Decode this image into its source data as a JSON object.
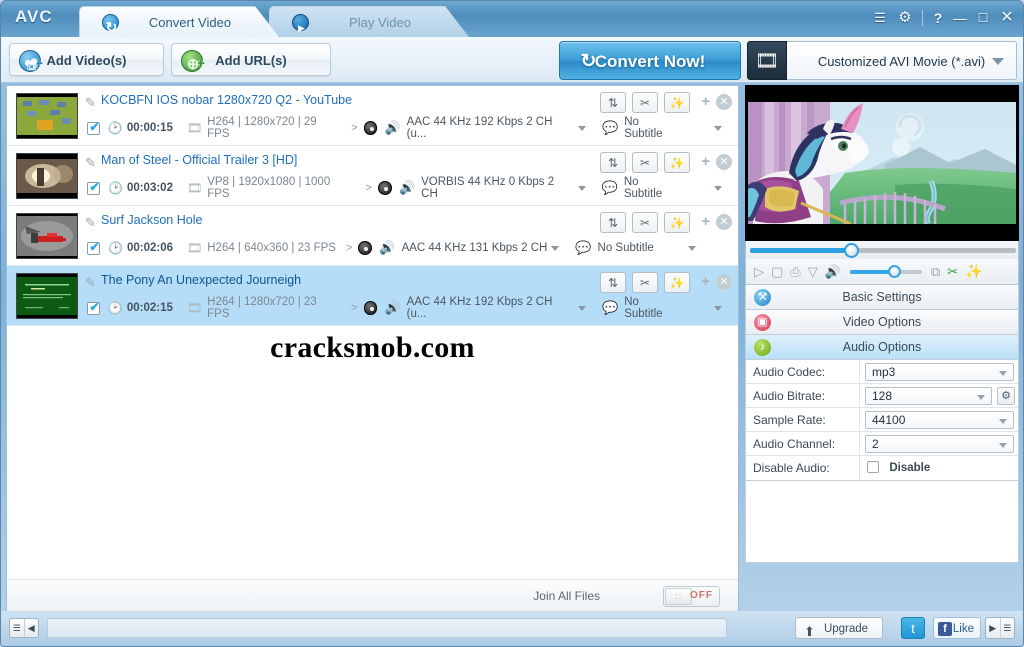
{
  "window": {
    "logo": "AVC",
    "controls": [
      {
        "name": "list-icon",
        "glyph": "☰"
      },
      {
        "name": "gear-icon",
        "glyph": "⚙"
      },
      {
        "name": "help-icon",
        "glyph": "?"
      },
      {
        "name": "minimize-icon",
        "glyph": "—"
      },
      {
        "name": "maximize-icon",
        "glyph": "☐"
      },
      {
        "name": "close-icon",
        "glyph": "✕"
      }
    ]
  },
  "tabs": [
    {
      "label": "Convert Video",
      "active": true
    },
    {
      "label": "Play Video",
      "active": false
    }
  ],
  "toolbar": {
    "add_video_label": "Add Video(s)",
    "add_url_label": "Add URL(s)",
    "convert_label": "Convert Now!",
    "convert_icon": "↻",
    "profile_value": "Customized AVI Movie (*.avi)"
  },
  "files": [
    {
      "title": "KOCBFN IOS nobar 1280x720 Q2 - YouTube",
      "duration": "00:00:15",
      "video_info": "H264 | 1280x720 | 29 FPS",
      "audio_info": "AAC 44 KHz 192 Kbps 2 CH (u...",
      "subtitle": "No Subtitle",
      "checked": true,
      "selected": false,
      "thumb": "game"
    },
    {
      "title": "Man of Steel - Official Trailer 3 [HD]",
      "duration": "00:03:02",
      "video_info": "VP8 | 1920x1080 | 1000 FPS",
      "audio_info": "VORBIS 44 KHz 0 Kbps 2 CH",
      "subtitle": "No Subtitle",
      "checked": true,
      "selected": false,
      "thumb": "trailer"
    },
    {
      "title": "Surf Jackson Hole",
      "duration": "00:02:06",
      "video_info": "H264 | 640x360 | 23 FPS",
      "audio_info": "AAC 44 KHz 131 Kbps 2 CH",
      "subtitle": "No Subtitle",
      "checked": true,
      "selected": false,
      "thumb": "surf"
    },
    {
      "title": "The Pony An Unexpected Journeigh",
      "duration": "00:02:15",
      "video_info": "H264 | 1280x720 | 23 FPS",
      "audio_info": "AAC 44 KHz 192 Kbps 2 CH (u...",
      "subtitle": "No Subtitle",
      "checked": true,
      "selected": true,
      "thumb": "pony"
    }
  ],
  "row_buttons": [
    {
      "name": "convert-row-icon",
      "glyph": "⇅"
    },
    {
      "name": "cut-row-icon",
      "glyph": "✂"
    },
    {
      "name": "effect-row-icon",
      "glyph": "✨"
    }
  ],
  "watermark": "cracksmob.com",
  "join": {
    "label": "Join All Files",
    "state": "OFF",
    "knob_glyph": "∷"
  },
  "player": {
    "seek_percent": 39,
    "volume_percent": 60,
    "buttons": [
      {
        "name": "play-icon",
        "glyph": "▷"
      },
      {
        "name": "stop-icon",
        "glyph": "▢"
      },
      {
        "name": "snapshot-icon",
        "glyph": "⎙"
      },
      {
        "name": "snapshot-menu-icon",
        "glyph": "▽"
      },
      {
        "name": "volume-icon",
        "glyph": "ὐA"
      }
    ],
    "right_buttons": [
      {
        "name": "fullscreen-icon",
        "glyph": "⧉"
      },
      {
        "name": "trim-icon",
        "glyph": "✂"
      },
      {
        "name": "effect-icon",
        "glyph": "✨"
      }
    ]
  },
  "sections": [
    {
      "label": "Basic Settings",
      "icon": "wrench-icon",
      "glyph": "⚒",
      "active": false
    },
    {
      "label": "Video Options",
      "icon": "film-icon",
      "glyph": "▣",
      "active": false
    },
    {
      "label": "Audio Options",
      "icon": "speaker-icon",
      "glyph": "♪",
      "active": true
    }
  ],
  "audio_options": [
    {
      "label": "Audio Codec:",
      "value": "mp3",
      "type": "select",
      "gear": false
    },
    {
      "label": "Audio Bitrate:",
      "value": "128",
      "type": "select",
      "gear": true
    },
    {
      "label": "Sample Rate:",
      "value": "44100",
      "type": "select",
      "gear": false
    },
    {
      "label": "Audio Channel:",
      "value": "2",
      "type": "select",
      "gear": false
    },
    {
      "label": "Disable Audio:",
      "value": "Disable",
      "type": "checkbox",
      "checked": false
    }
  ],
  "bottom": {
    "left_toggle": [
      "☰",
      "◀"
    ],
    "upgrade_label": "Upgrade",
    "upgrade_icon": "⬆",
    "twitter_label": "t",
    "like_label": "Like",
    "fb_label": "f",
    "right_toggle": [
      "▶",
      "☰"
    ]
  }
}
